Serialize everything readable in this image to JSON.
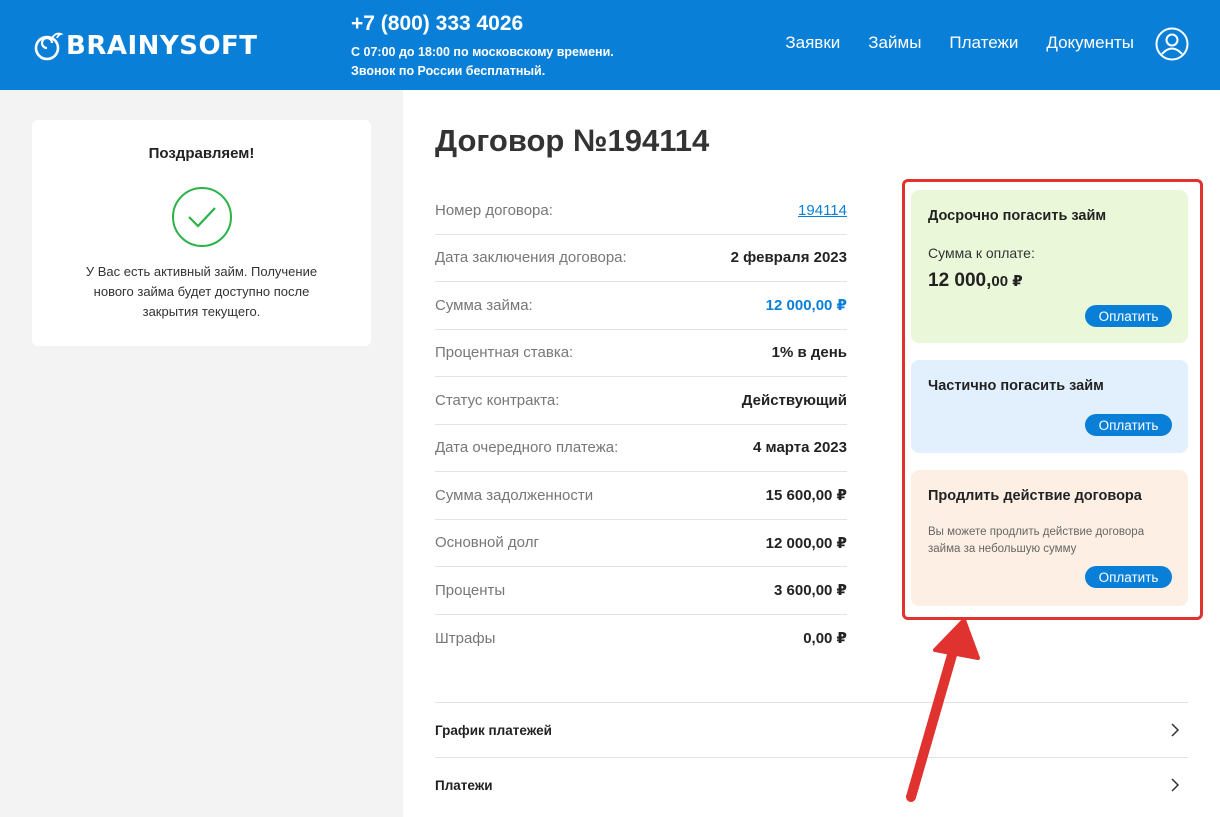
{
  "header": {
    "logo_text": "BRAINYSOFT",
    "phone": "+7 (800) 333 4026",
    "hours_line1": "С 07:00 до 18:00 по московскому времени.",
    "hours_line2": "Звонок по России бесплатный.",
    "nav": [
      "Заявки",
      "Займы",
      "Платежи",
      "Документы"
    ],
    "profile_icon": "user-circle-icon"
  },
  "sidebar": {
    "title": "Поздравляем!",
    "icon": "check-circle-icon",
    "message": "У Вас есть активный займ. Получение нового займа будет доступно после закрытия текущего."
  },
  "contract": {
    "title": "Договор №194114",
    "rows": [
      {
        "label": "Номер договора:",
        "value": "194114"
      },
      {
        "label": "Дата заключения договора:",
        "value": "2 февраля 2023"
      },
      {
        "label": "Сумма займа:",
        "value": "12 000,00 ₽"
      },
      {
        "label": "Процентная ставка:",
        "value": "1% в день"
      },
      {
        "label": "Статус контракта:",
        "value": "Действующий"
      },
      {
        "label": "Дата очередного платежа:",
        "value": "4 марта 2023"
      },
      {
        "label": "Сумма задолженности",
        "value": "15 600,00 ₽"
      },
      {
        "label": "Основной долг",
        "value": "12 000,00 ₽"
      },
      {
        "label": "Проценты",
        "value": "3 600,00 ₽"
      },
      {
        "label": "Штрафы",
        "value": "0,00 ₽"
      }
    ]
  },
  "actions": {
    "early": {
      "title": "Досрочно погасить займ",
      "sum_label": "Сумма к оплате:",
      "sum_main": "12 000,",
      "sum_cents": "00 ₽",
      "button": "Оплатить"
    },
    "partial": {
      "title": "Частично погасить займ",
      "button": "Оплатить"
    },
    "extend": {
      "title": "Продлить действие договора",
      "description": "Вы можете продлить действие договора займа за небольшую сумму",
      "button": "Оплатить"
    },
    "highlight_color": "#e0322f"
  },
  "accordions": [
    {
      "label": "График платежей",
      "icon": "chevron-right-icon"
    },
    {
      "label": "Платежи",
      "icon": "chevron-right-icon"
    }
  ],
  "colors": {
    "brand": "#0a7fd8",
    "early_bg": "#eaf8d9",
    "partial_bg": "#e2f0fd",
    "extend_bg": "#fdefe4"
  }
}
